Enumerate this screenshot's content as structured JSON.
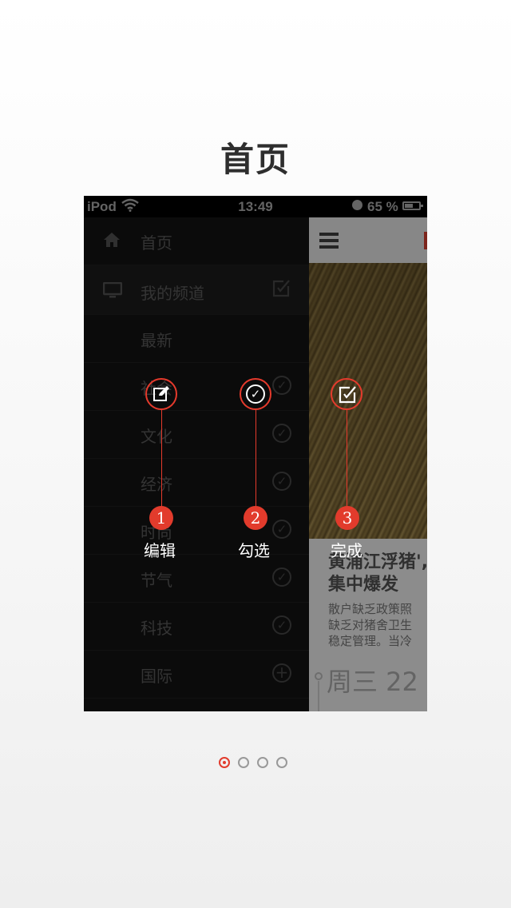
{
  "page": {
    "title": "首页"
  },
  "status_bar": {
    "carrier": "iPod",
    "time": "13:49",
    "battery_percent_label": "65 %",
    "battery_level": 0.65
  },
  "menu": {
    "items": [
      {
        "label": "首页",
        "icon": "home-icon"
      },
      {
        "label": "我的频道",
        "icon": "tv-icon",
        "action": "edit-icon"
      },
      {
        "label": "最新"
      },
      {
        "label": "社会",
        "status": "check-icon"
      },
      {
        "label": "文化",
        "status": "check-icon"
      },
      {
        "label": "经济",
        "status": "check-icon"
      },
      {
        "label": "时尚",
        "status": "check-icon"
      },
      {
        "label": "节气",
        "status": "check-icon"
      },
      {
        "label": "科技",
        "status": "check-icon"
      },
      {
        "label": "国际",
        "status": "plus-icon"
      }
    ]
  },
  "article": {
    "headline_line1": "黄浦江浮猪',",
    "headline_line2": "集中爆发",
    "summary_line1": "散户缺乏政策照",
    "summary_line2": "缺乏对猪舍卫生",
    "summary_line3": "稳定管理。当冷",
    "date": "周三 22"
  },
  "callouts": [
    {
      "number": "1",
      "label": "编辑",
      "icon": "edit-icon"
    },
    {
      "number": "2",
      "label": "勾选",
      "icon": "check-icon"
    },
    {
      "number": "3",
      "label": "完成",
      "icon": "done-icon"
    }
  ],
  "pager": {
    "count": 4,
    "active_index": 0
  },
  "colors": {
    "accent": "#e23b2c",
    "menu_bg": "#121212"
  }
}
